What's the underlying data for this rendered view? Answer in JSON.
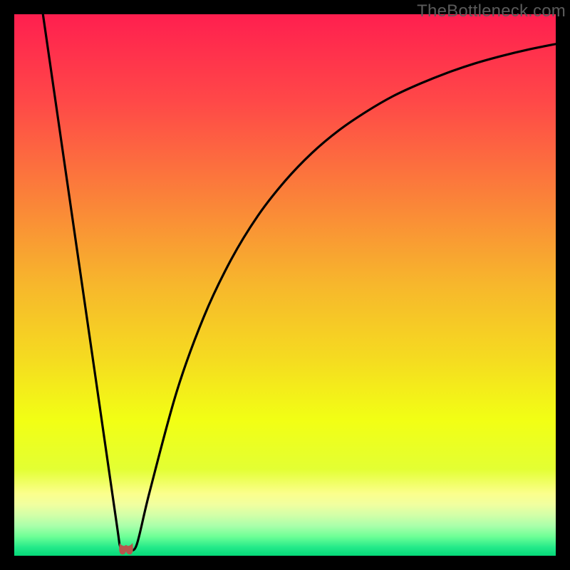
{
  "watermark": "TheBottleneck.com",
  "chart_data": {
    "type": "line",
    "title": "",
    "xlabel": "",
    "ylabel": "",
    "xlim": [
      0,
      100
    ],
    "ylim": [
      0,
      100
    ],
    "annotations": [],
    "background": {
      "type": "vertical-gradient",
      "stops": [
        {
          "offset": 0.0,
          "color": "#FF1F4F"
        },
        {
          "offset": 0.16,
          "color": "#FF4848"
        },
        {
          "offset": 0.33,
          "color": "#FB7F3A"
        },
        {
          "offset": 0.5,
          "color": "#F7B72C"
        },
        {
          "offset": 0.64,
          "color": "#F5DC20"
        },
        {
          "offset": 0.75,
          "color": "#F2FF14"
        },
        {
          "offset": 0.84,
          "color": "#E3FF33"
        },
        {
          "offset": 0.885,
          "color": "#FBFF8C"
        },
        {
          "offset": 0.905,
          "color": "#F1FF9F"
        },
        {
          "offset": 0.925,
          "color": "#D2FFA8"
        },
        {
          "offset": 0.945,
          "color": "#A9FFAA"
        },
        {
          "offset": 0.965,
          "color": "#6CFF96"
        },
        {
          "offset": 0.985,
          "color": "#22E989"
        },
        {
          "offset": 1.0,
          "color": "#05D878"
        }
      ]
    },
    "series": [
      {
        "name": "left-branch",
        "note": "near-linear descent from top-left to valley",
        "x": [
          5.3,
          10,
          15,
          18.9,
          19.5,
          20.0
        ],
        "y": [
          100,
          67.5,
          33.0,
          6.0,
          1.9,
          1.3
        ]
      },
      {
        "name": "right-branch",
        "note": "concave-down rise from valley toward top-right",
        "x": [
          21.3,
          22.6,
          25,
          30,
          35,
          40,
          45,
          50,
          55,
          60,
          65,
          70,
          75,
          80,
          85,
          90,
          95,
          100
        ],
        "y": [
          1.3,
          2.0,
          11.8,
          30.3,
          44.1,
          54.6,
          62.8,
          69.2,
          74.4,
          78.6,
          82.0,
          84.9,
          87.2,
          89.2,
          90.9,
          92.3,
          93.5,
          94.5
        ]
      }
    ],
    "valley_marker": {
      "shape": "u",
      "color": "#B8564D",
      "x_range": [
        19.5,
        21.8
      ],
      "y_range": [
        0.3,
        2.2
      ]
    }
  }
}
